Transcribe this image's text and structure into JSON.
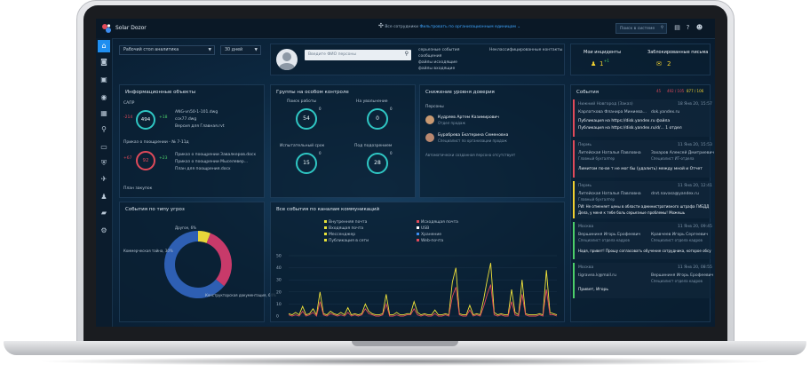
{
  "app": {
    "brand": "Solar Dozor",
    "nav_title": "Все сотрудники",
    "nav_subtitle": "Фильтровать по организационным единицам ⌄",
    "search_placeholder": "Поиск в системе"
  },
  "sidebar": {
    "items": [
      {
        "icon": "home-icon",
        "active": true
      },
      {
        "icon": "camera-icon"
      },
      {
        "icon": "inbox-icon"
      },
      {
        "icon": "globe-icon"
      },
      {
        "icon": "calendar-icon"
      },
      {
        "icon": "search-icon"
      },
      {
        "icon": "monitor-icon"
      },
      {
        "icon": "shield-icon"
      },
      {
        "icon": "plane-icon"
      },
      {
        "icon": "user-icon"
      },
      {
        "icon": "book-icon"
      },
      {
        "icon": "settings-icon"
      }
    ]
  },
  "toolbar": {
    "workspace": "Рабочий стол аналитика",
    "period": "30 дней"
  },
  "person_search": {
    "placeholder": "Введите ФИО персоны",
    "stats": [
      "серьезные события",
      "сообщения",
      "файлы исходящие",
      "файлы входящие"
    ],
    "contacts_label": "Неклассифицированные контакты"
  },
  "incidents": {
    "title": "Мои инциденты",
    "value": "1",
    "sup": "+1"
  },
  "blocked": {
    "title": "Заблокированные письма",
    "value": "2"
  },
  "info_objects": {
    "title": "Информационные объекты",
    "section1": "САПР",
    "ring1": "494",
    "ring1_delta": "-214",
    "ring1_side": "+18",
    "files1": [
      "ANG-vn50-1-101.dwg",
      "сск77.dwg",
      "Версия для Главная.rvt"
    ],
    "section2": "Приказ о поощрении - № 7-11д",
    "ring2": "92",
    "ring2_delta": "+67",
    "ring2_side": "+23",
    "files2": [
      "Приказ о поощрении Завалкеров.docx",
      "Приказ о поощрении Мыселевер...",
      "План для поощрения.docx"
    ],
    "footer": "План закупок"
  },
  "watch_groups": {
    "title": "Группы на особом контроле",
    "groups": [
      {
        "label": "Поиск работы",
        "value": "54",
        "badge": "0"
      },
      {
        "label": "На увольнение",
        "value": "0",
        "badge": "0"
      },
      {
        "label": "Испытательный срок",
        "value": "15",
        "badge": "0"
      },
      {
        "label": "Под подозрением",
        "value": "28",
        "badge": "0"
      }
    ]
  },
  "trust": {
    "title": "Снижение уровня доверия",
    "section": "Персоны",
    "persons": [
      {
        "name": "Кудряев Артем Казимирович",
        "role": "Отдел продаж"
      },
      {
        "name": "Бурабрева Екатерина Семеновна",
        "role": "Специалист по организации продаж"
      }
    ],
    "footer": "Автоматически созданная персона отсутствует"
  },
  "events": {
    "title": "События",
    "red_count": "45",
    "mid_count": "492 / 105",
    "yellow_count": "877 / 106",
    "items": [
      {
        "group": "Нижний Новгород (Заказ)",
        "date": "18 Янв 20, 15:57",
        "from": "Карлаткова Фланира Миниева...",
        "to": "dok.yandex.ru",
        "subject": "Публикация на https://disk.yandex.ru файла",
        "text": "Публикация на https://disk.yandex.ru/d/... 1 отдел",
        "color": "red"
      },
      {
        "group": "Пермь",
        "date": "11 Янв 20, 15:53",
        "from": "Литейская Наталья Павловна",
        "to": "Захаров Алексей Дмитриевич",
        "role1": "Главный бухгалтер",
        "role2": "Специалист ИТ-отдела",
        "subject": "Лимитом по-ве т не мог бы (удалить) между мной и Отчет",
        "color": "red"
      },
      {
        "group": "Пермь",
        "date": "11 Янв 20, 12:41",
        "from": "Литейская Наталья Павловна",
        "to": "drvt.navasa@yandex.ru",
        "role1": "Главный бухгалтер",
        "subject": "FW: Не отменяет цены в области административного штрафа ГИБДД",
        "text": "Дела, у меня к тебе боль серьезные проблемы! Можешь",
        "color": "yellow"
      },
      {
        "group": "Москва",
        "date": "11 Янв 20, 09:45",
        "from": "Вершининя Игорь Ерофеевич",
        "to": "Кравчеев Игорь Сергеевич",
        "role1": "Специалист отдела кадров",
        "role2": "Специалист отдела кадров",
        "subject": "Надя, привет! Прошу согласовать обучение сотрудника, которое обсу",
        "color": "green"
      },
      {
        "group": "Москва",
        "date": "11 Янв 20, 08:55",
        "from": "tigravea.k@mail.ru",
        "to": "Вершининя Игорь Ерофеевич",
        "role2": "Специалист отдела кадров",
        "subject": "Привет, Игорь",
        "color": "green"
      }
    ]
  },
  "threat_types": {
    "title": "События по типу угроз",
    "segments": [
      {
        "label": "Другое, 6%",
        "value": 6,
        "color": "#e8d63a"
      },
      {
        "label": "Коммерческая тайна, 30%",
        "value": 30,
        "color": "#c83a6a"
      },
      {
        "label": "Конструкторская документация, 64%",
        "value": 64,
        "color": "#2e5fb3"
      }
    ]
  },
  "channels": {
    "title": "Все события по каналам коммуникаций",
    "legend": [
      {
        "label": "Внутренняя почта",
        "color": "#e8e23a"
      },
      {
        "label": "Исходящая почта",
        "color": "#e04a5a"
      },
      {
        "label": "Входящая почта",
        "color": "#e8e23a"
      },
      {
        "label": "USB",
        "color": "#ffffff"
      },
      {
        "label": "Мессенджер",
        "color": "#e8e23a"
      },
      {
        "label": "Хранение",
        "color": "#3c8df0"
      },
      {
        "label": "Публикация в сети",
        "color": "#e8e23a"
      },
      {
        "label": "Web-почта",
        "color": "#e04a5a"
      }
    ]
  },
  "chart_data": {
    "type": "line",
    "yticks": [
      "50",
      "40",
      "30",
      "20",
      "10",
      "0"
    ],
    "ylim": [
      0,
      50
    ],
    "series": [
      {
        "color": "#f0e23a",
        "values": [
          2,
          1,
          3,
          1,
          8,
          1,
          2,
          6,
          1,
          20,
          2,
          1,
          4,
          2,
          1,
          3,
          1,
          7,
          1,
          2,
          1,
          2,
          10,
          4,
          2,
          1,
          1,
          2,
          18,
          1,
          1,
          3,
          1,
          1,
          2,
          2,
          12,
          3,
          1,
          2,
          1,
          1,
          5,
          1,
          1,
          2,
          1,
          28,
          40,
          2,
          1,
          1,
          9,
          1,
          2,
          1,
          14,
          30,
          44,
          3,
          1,
          2,
          1,
          1,
          22,
          3,
          1,
          30,
          2,
          1,
          1,
          1,
          2,
          1,
          38,
          3,
          2,
          1
        ]
      },
      {
        "color": "#e04a5a",
        "values": [
          1,
          0,
          1,
          0,
          4,
          0,
          1,
          3,
          0,
          12,
          1,
          0,
          2,
          1,
          0,
          1,
          0,
          3,
          0,
          1,
          0,
          1,
          6,
          2,
          1,
          0,
          0,
          1,
          10,
          0,
          0,
          1,
          0,
          0,
          1,
          1,
          6,
          1,
          0,
          1,
          0,
          0,
          2,
          0,
          0,
          1,
          0,
          16,
          24,
          1,
          0,
          0,
          5,
          0,
          1,
          0,
          8,
          18,
          26,
          1,
          0,
          1,
          0,
          0,
          12,
          1,
          0,
          18,
          1,
          0,
          0,
          0,
          1,
          0,
          22,
          1,
          1,
          0
        ]
      }
    ]
  }
}
